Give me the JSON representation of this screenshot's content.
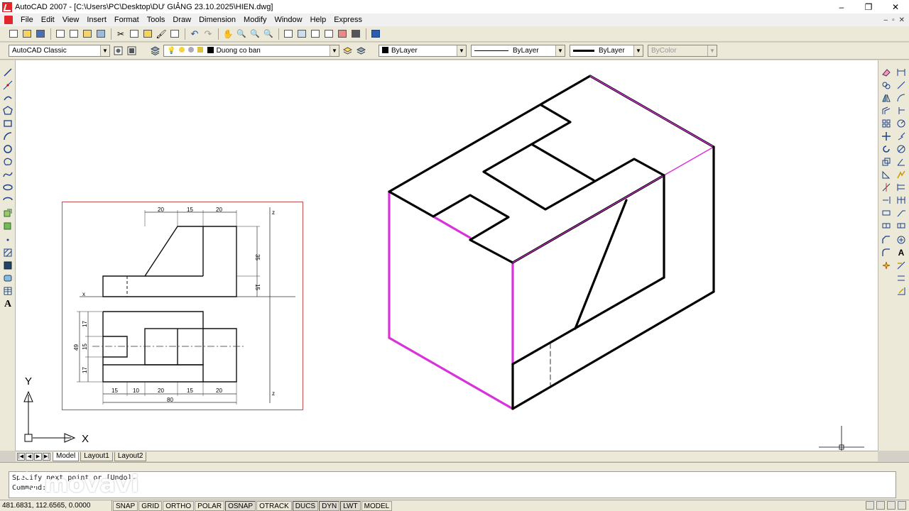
{
  "window": {
    "title": "AutoCAD 2007 - [C:\\Users\\PC\\Desktop\\DƯ GIẢNG 23.10.2025\\HIEN.dwg]",
    "minimize": "–",
    "maximize": "❐",
    "close": "✕"
  },
  "menu": {
    "items": [
      "File",
      "Edit",
      "View",
      "Insert",
      "Format",
      "Tools",
      "Draw",
      "Dimension",
      "Modify",
      "Window",
      "Help",
      "Express"
    ],
    "doc_controls": [
      "–",
      "▫",
      "✕"
    ]
  },
  "toolbar2": {
    "workspace": "AutoCAD Classic",
    "layer": "Duong co ban",
    "color": "ByLayer",
    "linetype": "ByLayer",
    "lineweight": "ByLayer",
    "plotstyle": "ByColor"
  },
  "drawing": {
    "ortho_x_label": "x",
    "ortho_z_top": "z",
    "ortho_z_bottom": "z",
    "dim_top": [
      "20",
      "15",
      "20"
    ],
    "dim_right_upper": "35",
    "dim_right_lower": "15",
    "dim_left": [
      "17",
      "15",
      "17"
    ],
    "dim_left_total": "49",
    "dim_bottom": [
      "15",
      "10",
      "20",
      "15",
      "20"
    ],
    "dim_bottom_total": "80",
    "ucs_y": "Y",
    "ucs_x": "X",
    "colors": {
      "magenta_edge": "#d932d9",
      "frame": "#c0504d"
    }
  },
  "tabs": {
    "items": [
      "Model",
      "Layout1",
      "Layout2"
    ],
    "active": "Model"
  },
  "command": {
    "line1": "Specify next point or [Undo]:",
    "line2": "Command:"
  },
  "watermark": {
    "text": "movavi"
  },
  "status": {
    "coords": "481.6831, 112.6565, 0.0000",
    "toggles": [
      "SNAP",
      "GRID",
      "ORTHO",
      "POLAR",
      "OSNAP",
      "OTRACK",
      "DUCS",
      "DYN",
      "LWT",
      "MODEL"
    ]
  }
}
